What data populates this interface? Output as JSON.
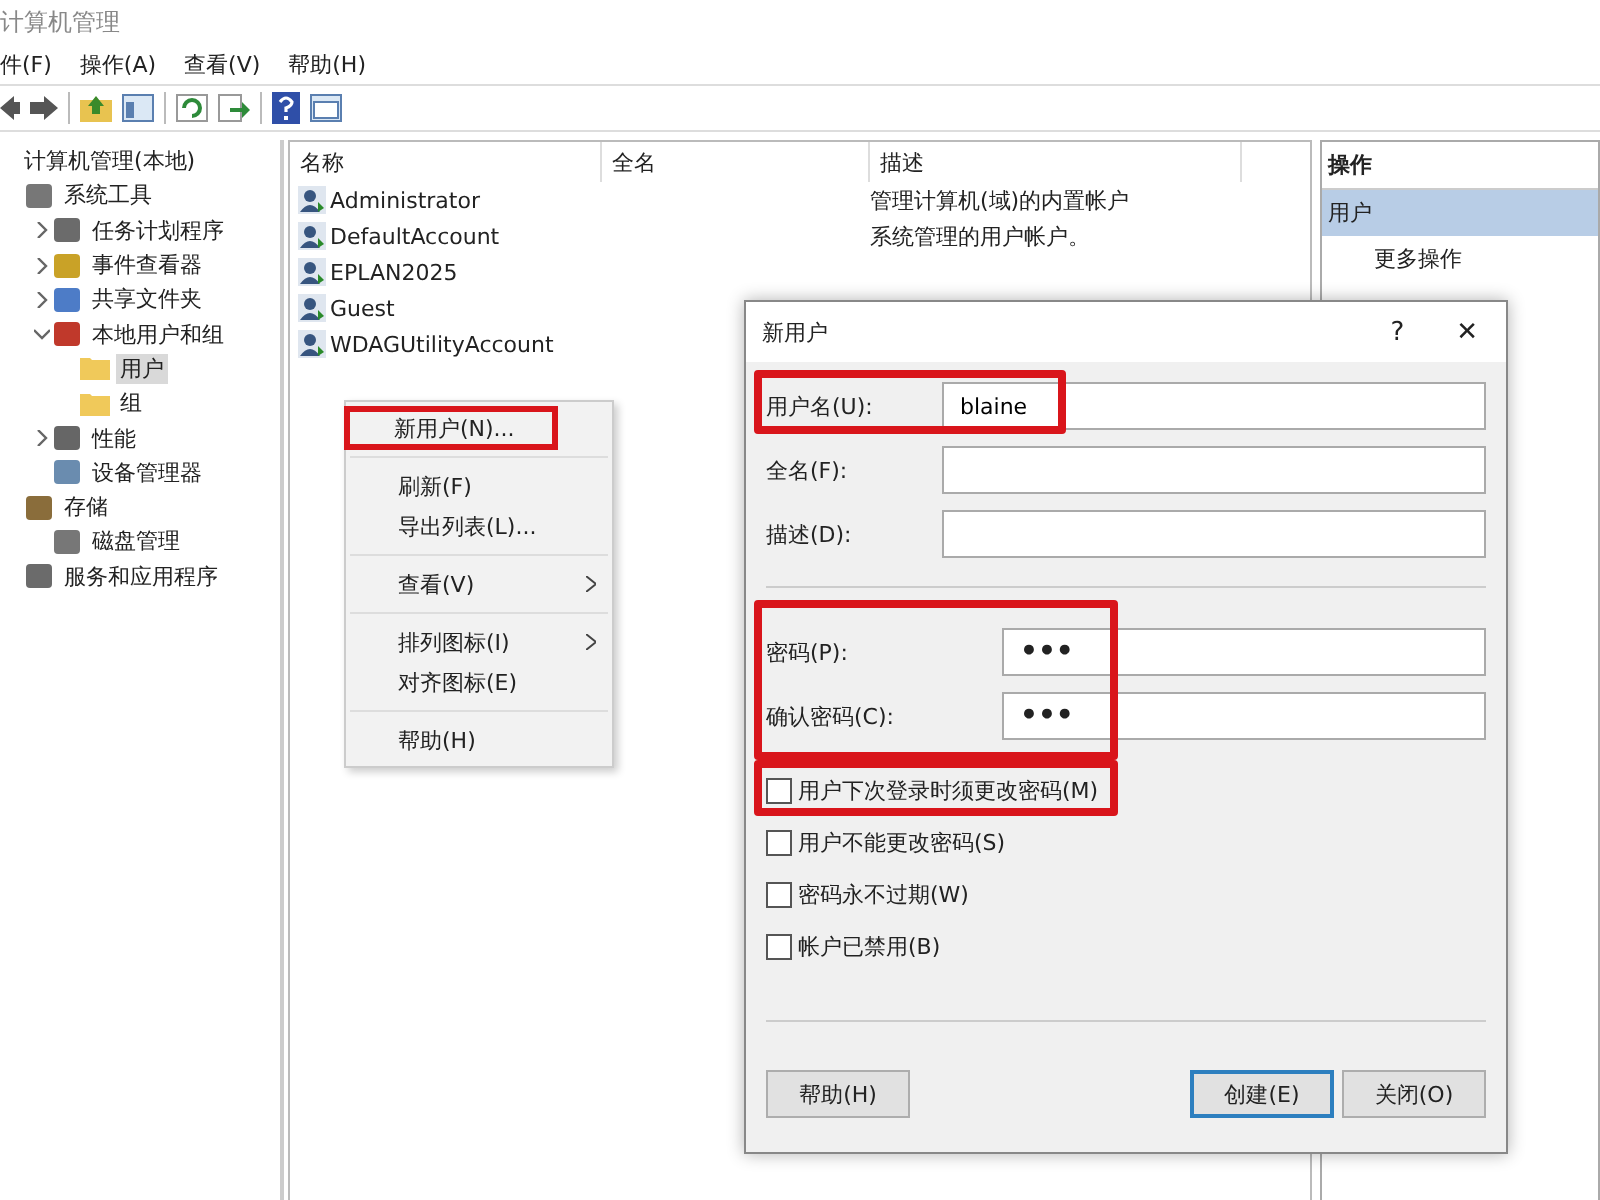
{
  "window": {
    "title": "计算机管理"
  },
  "menu_bar": [
    "件(F)",
    "操作(A)",
    "查看(V)",
    "帮助(H)"
  ],
  "tree": [
    {
      "label": "计算机管理(本地)",
      "selected": false,
      "children": [
        {
          "label": "系统工具",
          "selected": false,
          "children": [
            {
              "label": "任务计划程序",
              "selected": false,
              "expanded": false
            },
            {
              "label": "事件查看器",
              "selected": false,
              "expanded": false
            },
            {
              "label": "共享文件夹",
              "selected": false,
              "expanded": false
            },
            {
              "label": "本地用户和组",
              "selected": false,
              "expanded": true,
              "children": [
                {
                  "label": "用户",
                  "selected": true
                },
                {
                  "label": "组",
                  "selected": false
                }
              ]
            },
            {
              "label": "性能",
              "selected": false,
              "expanded": false
            },
            {
              "label": "设备管理器",
              "selected": false
            }
          ]
        },
        {
          "label": "存储",
          "selected": false,
          "children": [
            {
              "label": "磁盘管理",
              "selected": false
            }
          ]
        },
        {
          "label": "服务和应用程序",
          "selected": false
        }
      ]
    }
  ],
  "list": {
    "columns": [
      "名称",
      "全名",
      "描述"
    ],
    "rows": [
      {
        "name": "Administrator",
        "description": "管理计算机(域)的内置帐户"
      },
      {
        "name": "DefaultAccount",
        "description": "系统管理的用户帐户。"
      },
      {
        "name": "EPLAN2025"
      },
      {
        "name": "Guest"
      },
      {
        "name": "WDAGUtilityAccount"
      }
    ]
  },
  "actions": {
    "title": "操作",
    "section": "用户",
    "items": [
      "更多操作"
    ]
  },
  "context_menu": [
    {
      "kind": "item",
      "label": "新用户(N)...",
      "submenu": false,
      "highlighted": true
    },
    {
      "kind": "separator"
    },
    {
      "kind": "item",
      "label": "刷新(F)",
      "submenu": false,
      "highlighted": false
    },
    {
      "kind": "item",
      "label": "导出列表(L)...",
      "submenu": false,
      "highlighted": false
    },
    {
      "kind": "separator"
    },
    {
      "kind": "item",
      "label": "查看(V)",
      "submenu": true,
      "highlighted": false
    },
    {
      "kind": "separator"
    },
    {
      "kind": "item",
      "label": "排列图标(I)",
      "submenu": true,
      "highlighted": false
    },
    {
      "kind": "item",
      "label": "对齐图标(E)",
      "submenu": false,
      "highlighted": false
    },
    {
      "kind": "separator"
    },
    {
      "kind": "item",
      "label": "帮助(H)",
      "submenu": false,
      "highlighted": false
    }
  ],
  "dialog": {
    "title": "新用户",
    "help_glyph": "?",
    "close_glyph": "✕",
    "fields": [
      {
        "label": "用户名(U):",
        "value": "blaine",
        "highlighted": true
      },
      {
        "label": "全名(F):",
        "highlighted": false
      },
      {
        "label": "描述(D):",
        "highlighted": false
      }
    ],
    "password_section_highlighted": true,
    "password_fields": [
      {
        "label": "密码(P):",
        "value": "•••"
      },
      {
        "label": "确认密码(C):",
        "value": "•••"
      }
    ],
    "checkboxes": [
      {
        "label": "用户下次登录时须更改密码(M)",
        "checked": false,
        "highlighted": true
      },
      {
        "label": "用户不能更改密码(S)",
        "checked": false,
        "highlighted": false
      },
      {
        "label": "密码永不过期(W)",
        "checked": false,
        "highlighted": false
      },
      {
        "label": "帐户已禁用(B)",
        "checked": false,
        "highlighted": false
      }
    ],
    "buttons": [
      {
        "label": "帮助(H)",
        "default": false
      },
      {
        "label": "创建(E)",
        "default": true
      },
      {
        "label": "关闭(O)",
        "default": false
      }
    ]
  }
}
